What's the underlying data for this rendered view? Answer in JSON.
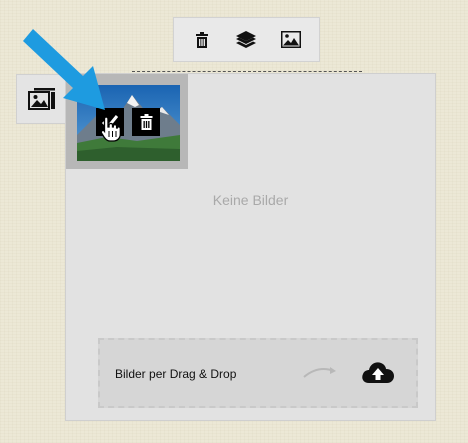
{
  "toolbar": {
    "items": [
      {
        "name": "trash-icon",
        "label": "delete"
      },
      {
        "name": "layers-icon",
        "label": "layers"
      },
      {
        "name": "image-icon",
        "label": "image"
      }
    ]
  },
  "gallery": {
    "empty_text": "Keine Bilder",
    "side_tab_icon": "image-stack-icon",
    "thumbnail": {
      "edit_icon": "checkmark-icon",
      "delete_icon": "trash-icon"
    }
  },
  "dropzone": {
    "label": "Bilder per Drag & Drop",
    "arrow_icon": "curved-arrow-icon",
    "upload_icon": "cloud-upload-icon"
  },
  "colors": {
    "background": "#ece8d6",
    "panel": "#e2e2e2",
    "pointer_arrow": "#1e9be0"
  }
}
